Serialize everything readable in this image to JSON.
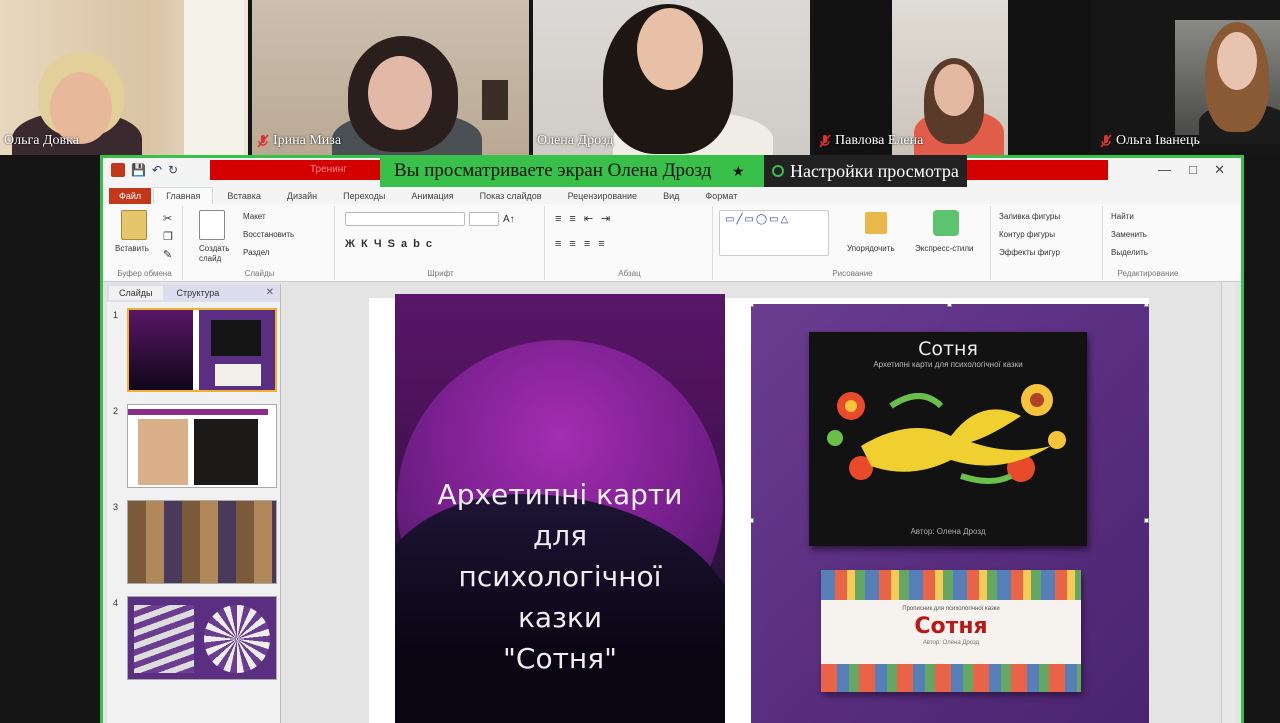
{
  "participants": [
    {
      "name": "Ольга Довка",
      "muted": false
    },
    {
      "name": "Ірина Миза",
      "muted": true
    },
    {
      "name": "Олена Дрозд",
      "muted": false
    },
    {
      "name": "Павлова Елена",
      "muted": true
    },
    {
      "name": "Ольга Іванець",
      "muted": true
    }
  ],
  "share_banner": {
    "text": "Вы просматриваете экран Олена Дрозд",
    "view_options": "Настройки просмотра",
    "red_label": "Тренинг"
  },
  "ppt": {
    "tabs": [
      "Файл",
      "Главная",
      "Вставка",
      "Дизайн",
      "Переходы",
      "Анимация",
      "Показ слайдов",
      "Рецензирование",
      "Вид",
      "Формат"
    ],
    "clipboard": {
      "paste": "Вставить",
      "label": "Буфер обмена"
    },
    "slides_group": {
      "create": "Создать слайд",
      "layout": "Макет",
      "reset": "Восстановить",
      "section": "Раздел",
      "label": "Слайды"
    },
    "font_group": {
      "label": "Шрифт"
    },
    "paragraph_group": {
      "label": "Абзац"
    },
    "drawing_group": {
      "arrange": "Упорядочить",
      "quick_styles": "Экспресс-стили",
      "fill": "Заливка фигуры",
      "outline": "Контур фигуры",
      "effects": "Эффекты фигур",
      "label": "Рисование"
    },
    "editing_group": {
      "find": "Найти",
      "replace": "Заменить",
      "select": "Выделить",
      "label": "Редактирование"
    },
    "pane_tabs": [
      "Слайды",
      "Структура"
    ],
    "slide_numbers": [
      "1",
      "2",
      "3",
      "4"
    ]
  },
  "slide": {
    "cover_lines": [
      "Архетипні карти",
      "для",
      "психологічної",
      "казки",
      "\"Сотня\""
    ],
    "card1_title": "Сотня",
    "card1_subtitle": "Архетипні карти для психологічної казки",
    "card1_author": "Автор: Олена Дрозд",
    "card2_title": "Сотня",
    "card2_subtitle": "Прописник для психологічної казки",
    "card2_author": "Автор: Олена Дрозд"
  },
  "colors": {
    "share_border": "#39c04a",
    "file_tab": "#c3381a",
    "alert_red": "#d40000"
  }
}
